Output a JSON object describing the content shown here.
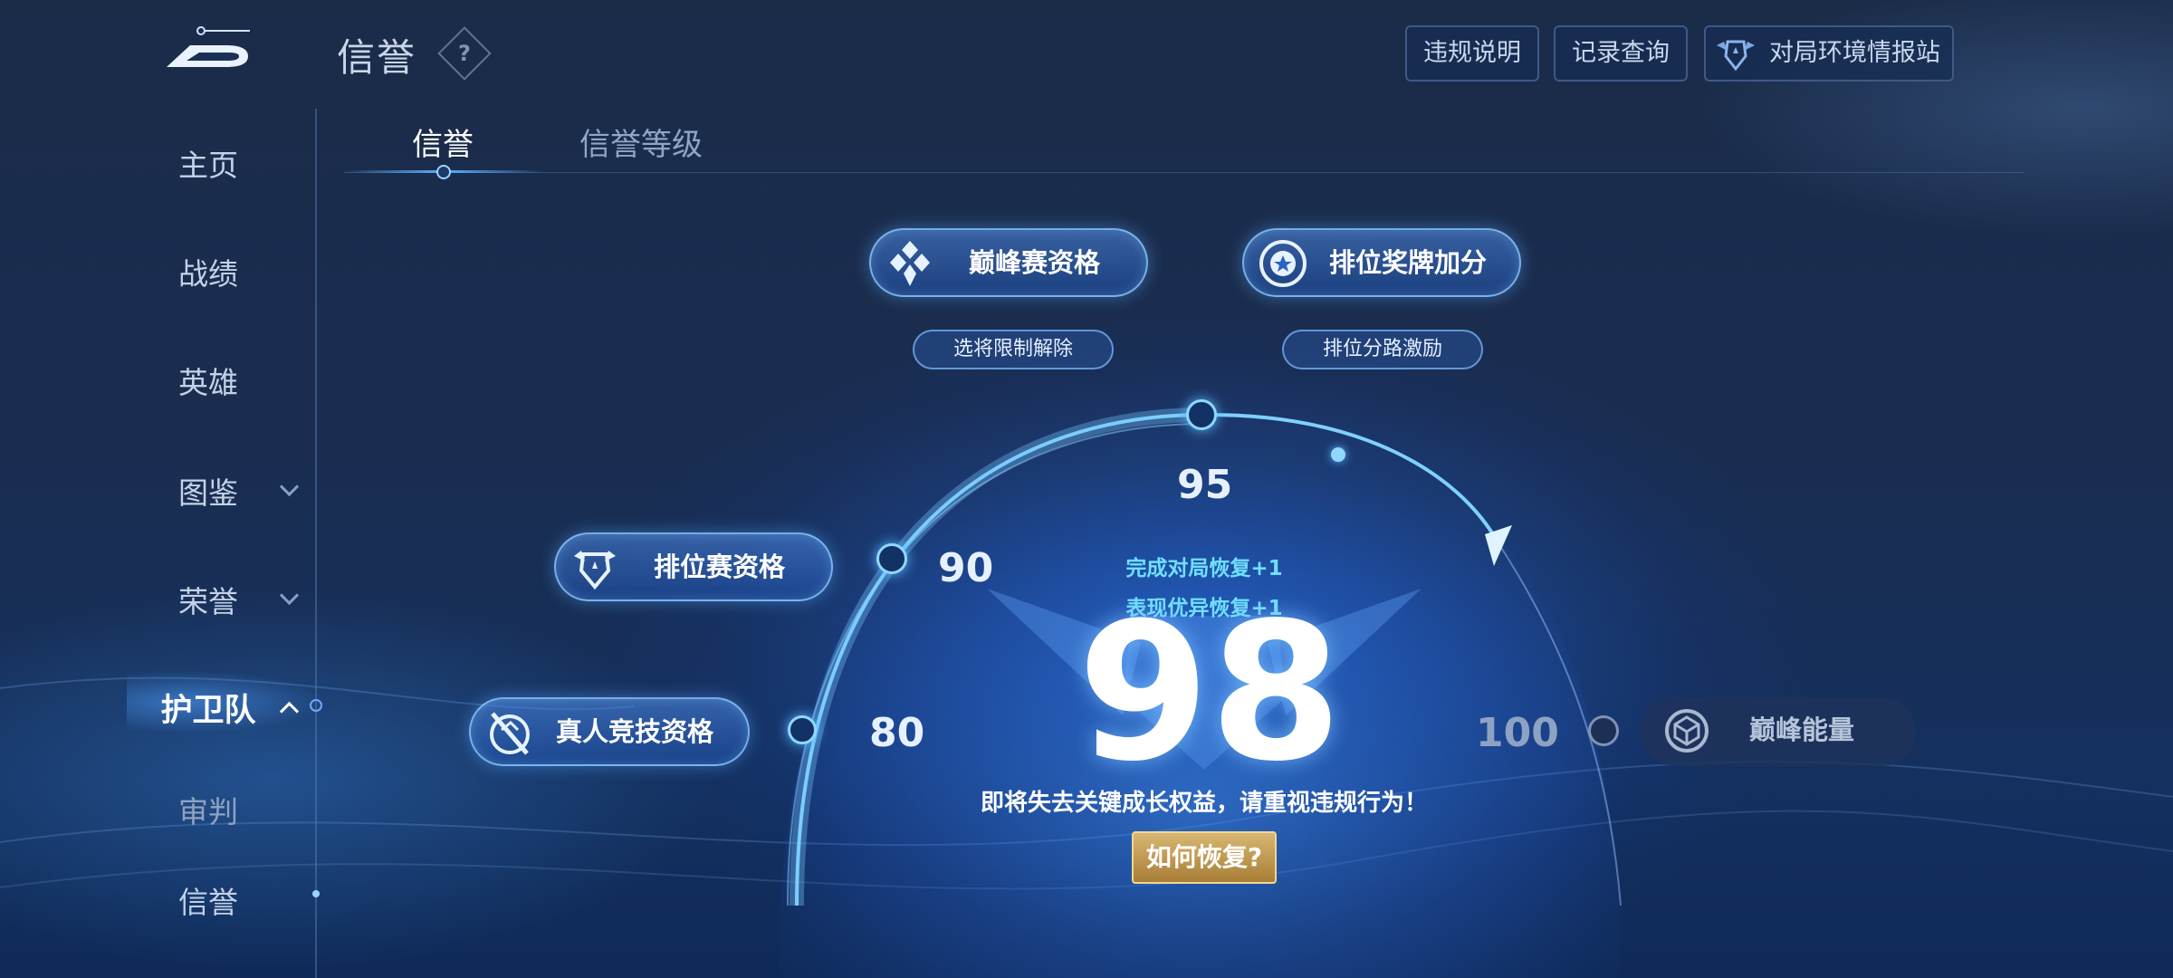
{
  "header": {
    "title": "信誉",
    "help_icon": "?",
    "buttons": {
      "rules": "违规说明",
      "records": "记录查询",
      "environment": "对局环境情报站"
    }
  },
  "sidebar": {
    "items": [
      {
        "label": "主页"
      },
      {
        "label": "战绩"
      },
      {
        "label": "英雄"
      },
      {
        "label": "图鉴"
      },
      {
        "label": "荣誉"
      },
      {
        "label": "护卫队"
      },
      {
        "label": "审判"
      },
      {
        "label": "信誉"
      }
    ],
    "active": "护卫队"
  },
  "tabs": [
    {
      "label": "信誉",
      "active": true
    },
    {
      "label": "信誉等级",
      "active": false
    }
  ],
  "privileges": {
    "peak_match": "巅峰赛资格",
    "rank_medal": "排位奖牌加分",
    "hero_restriction": "选将限制解除",
    "rank_lane": "排位分路激励",
    "ranked_match": "排位赛资格",
    "human_match": "真人竞技资格",
    "peak_energy": "巅峰能量"
  },
  "score": {
    "value": "98",
    "tick_80": "80",
    "tick_90": "90",
    "tick_95": "95",
    "tick_100": "100",
    "recover_match": "完成对局恢复+1",
    "recover_performance": "表现优异恢复+1",
    "warning": "即将失去关键成长权益，请重视违规行为！",
    "how_to_recover": "如何恢复?"
  },
  "colors": {
    "accent": "#5ab0ff",
    "gold_button": "#c9a55a",
    "recover_text": "#6fe0ff"
  }
}
